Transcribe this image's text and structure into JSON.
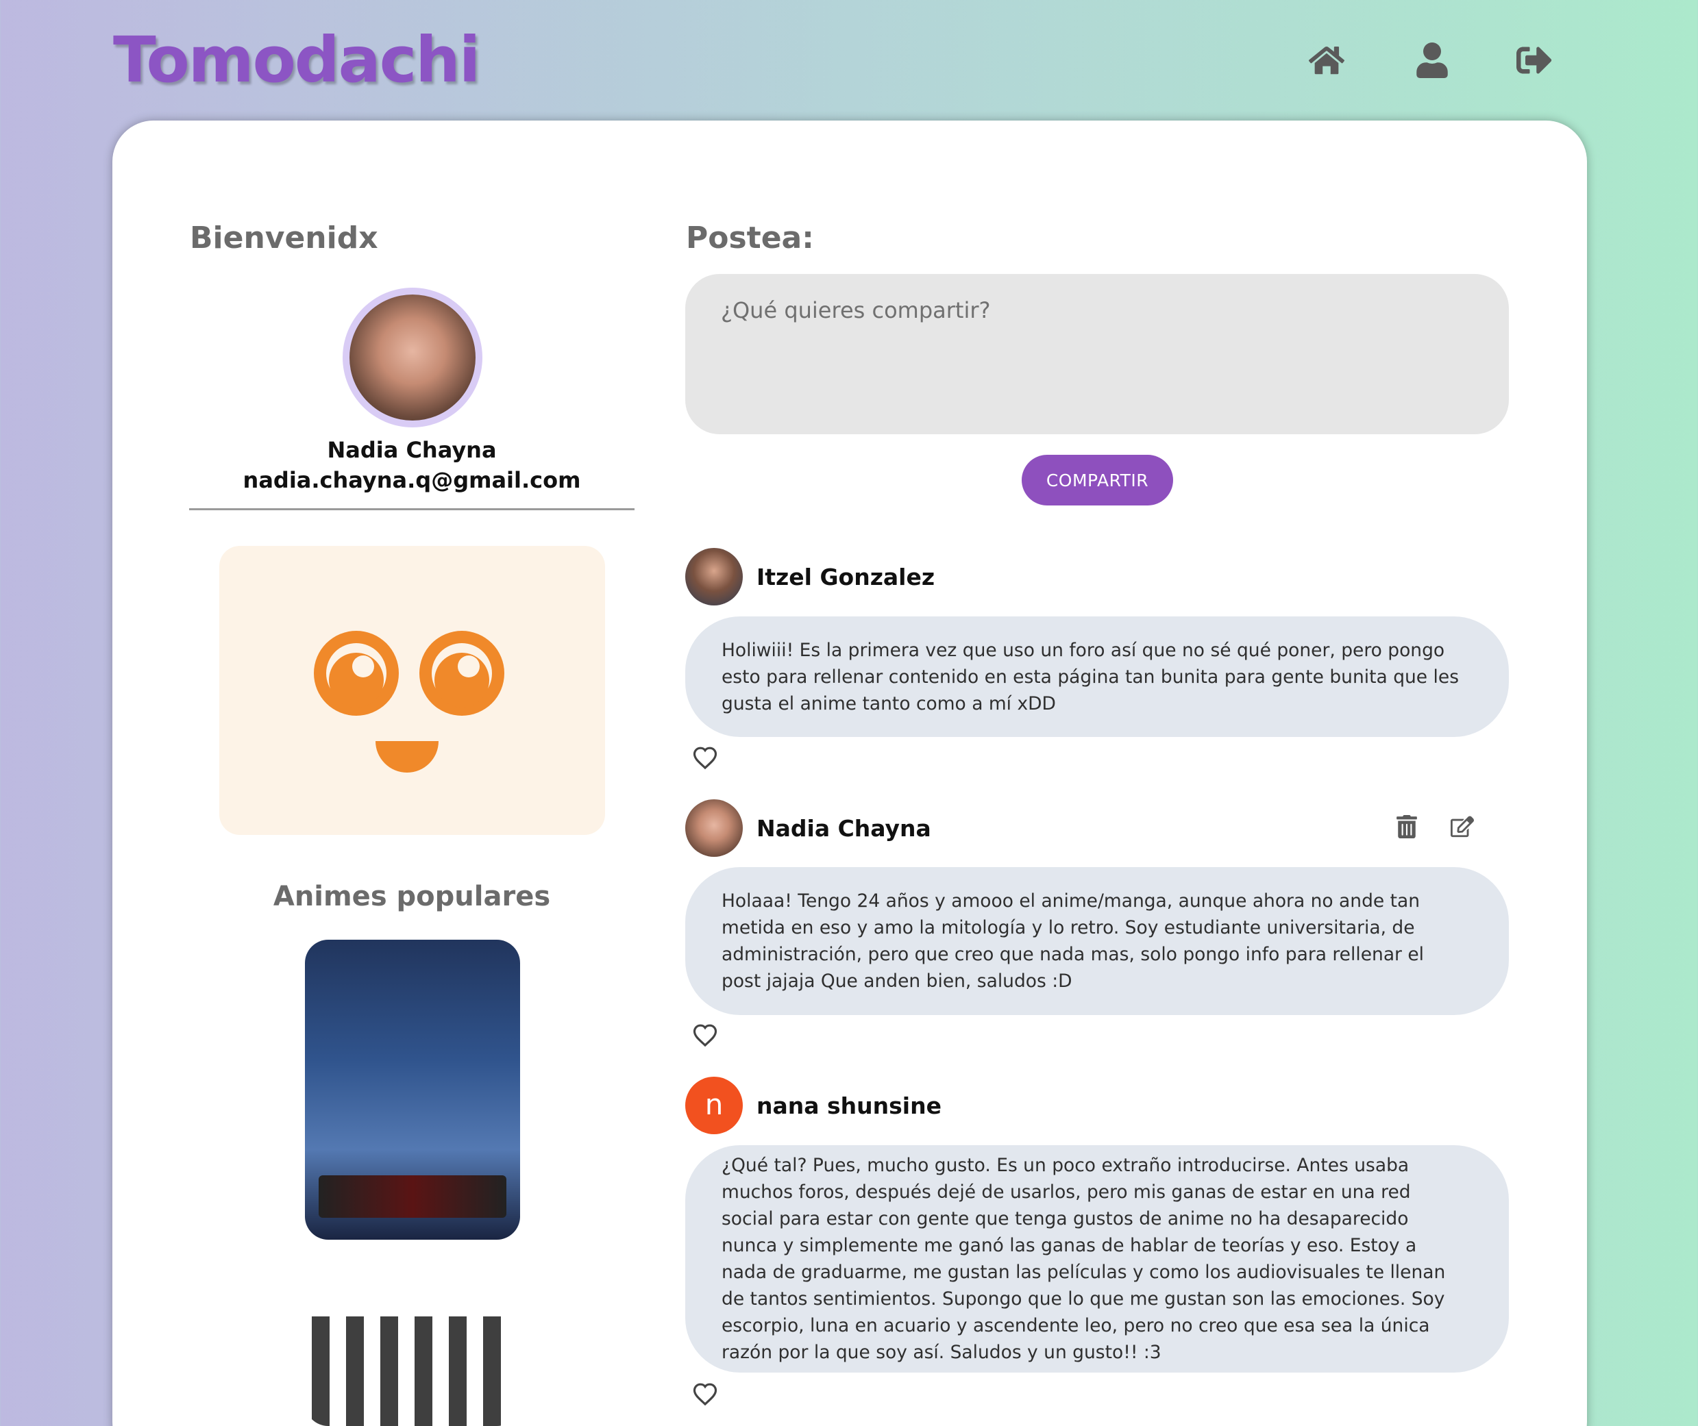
{
  "header": {
    "logo": "Tomodachi",
    "nav": [
      {
        "icon": "home-icon"
      },
      {
        "icon": "user-icon"
      },
      {
        "icon": "logout-icon"
      }
    ]
  },
  "sidebar": {
    "welcome": "Bienvenidx",
    "user_name": "Nadia Chayna",
    "user_email": "nadia.chayna.q@gmail.com",
    "popular_title": "Animes populares"
  },
  "composer": {
    "title": "Postea:",
    "placeholder": "¿Qué quieres compartir?",
    "value": "",
    "button": "COMPARTIR"
  },
  "posts": [
    {
      "author": "Itzel Gonzalez",
      "text": "Holiwiii! Es la primera vez que uso un foro así que no sé qué poner, pero pongo esto para rellenar contenido en esta página tan bunita para gente bunita que les gusta el anime tanto como a mí xDD",
      "can_edit": false
    },
    {
      "author": "Nadia Chayna",
      "text": "Holaaa! Tengo 24 años y amooo el anime/manga, aunque ahora no ande tan metida en eso y amo la mitología y lo retro. Soy estudiante universitaria, de administración, pero que creo que nada mas, solo pongo info para rellenar el post jajaja Que anden bien, saludos :D",
      "can_edit": true
    },
    {
      "author": "nana shunsine",
      "avatar_letter": "n",
      "text": "¿Qué tal? Pues, mucho gusto. Es un poco extraño introducirse. Antes usaba muchos foros, después dejé de usarlos, pero mis ganas de estar en una red social para estar con gente que tenga gustos de anime no ha desaparecido nunca y simplemente me ganó las ganas de hablar de teorías y eso. Estoy a nada de graduarme, me gustan las películas y como los audiovisuales te llenan de tantos sentimientos. Supongo que lo que me gustan son las emociones. Soy escorpio, luna en acuario y ascendente leo, pero no creo que esa sea la única razón por la que soy así. Saludos y un gusto!! :3",
      "can_edit": false
    }
  ],
  "colors": {
    "brand": "#8c55c4",
    "button": "#8e50be",
    "bubble": "#e2e7ee",
    "mascot_orange": "#f0892a",
    "letter_avatar": "#f2511f"
  }
}
